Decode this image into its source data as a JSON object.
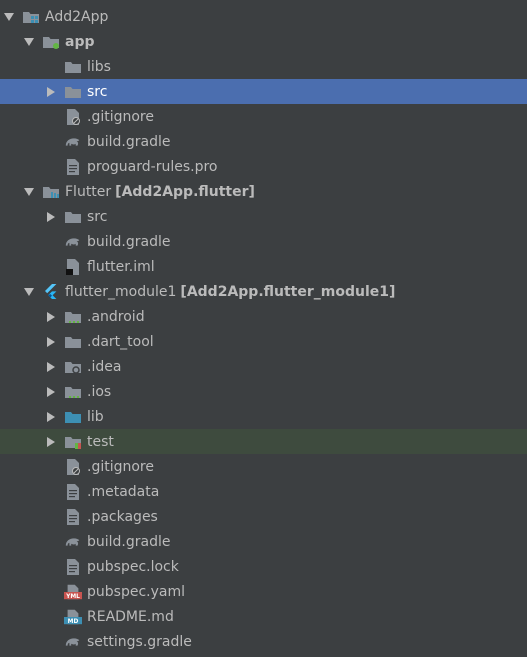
{
  "colors": {
    "background": "#3c3f41",
    "selected_row": "#4b6eaf",
    "highlight_row": "#3e4b3e",
    "folder": "#8a9199",
    "text": "#bbbbbb"
  },
  "rows": [
    {
      "id": "add2app",
      "label": "Add2App",
      "depth": 0,
      "arrow": "down",
      "icon": "project-module-icon",
      "bold": false,
      "suffix": ""
    },
    {
      "id": "app",
      "label": "app",
      "depth": 1,
      "arrow": "down",
      "icon": "android-module-folder-icon",
      "bold": true,
      "suffix": ""
    },
    {
      "id": "libs",
      "label": "libs",
      "depth": 2,
      "arrow": "none",
      "icon": "folder-icon",
      "bold": false,
      "suffix": ""
    },
    {
      "id": "src",
      "label": "src",
      "depth": 2,
      "arrow": "right",
      "icon": "folder-icon",
      "bold": false,
      "suffix": "",
      "selected": true
    },
    {
      "id": "app-gitignore",
      "label": ".gitignore",
      "depth": 2,
      "arrow": "none",
      "icon": "ignore-file-icon",
      "bold": false,
      "suffix": ""
    },
    {
      "id": "app-build-gradle",
      "label": "build.gradle",
      "depth": 2,
      "arrow": "none",
      "icon": "gradle-icon",
      "bold": false,
      "suffix": ""
    },
    {
      "id": "proguard",
      "label": "proguard-rules.pro",
      "depth": 2,
      "arrow": "none",
      "icon": "text-file-icon",
      "bold": false,
      "suffix": ""
    },
    {
      "id": "flutter",
      "label": "Flutter",
      "depth": 1,
      "arrow": "down",
      "icon": "library-module-folder-icon",
      "bold": false,
      "suffix": "[Add2App.flutter]"
    },
    {
      "id": "flutter-src",
      "label": "src",
      "depth": 2,
      "arrow": "right",
      "icon": "folder-icon",
      "bold": false,
      "suffix": ""
    },
    {
      "id": "flutter-build-gradle",
      "label": "build.gradle",
      "depth": 2,
      "arrow": "none",
      "icon": "gradle-icon",
      "bold": false,
      "suffix": ""
    },
    {
      "id": "flutter-iml",
      "label": "flutter.iml",
      "depth": 2,
      "arrow": "none",
      "icon": "iml-file-icon",
      "bold": false,
      "suffix": ""
    },
    {
      "id": "flutter-module1",
      "label": "flutter_module1",
      "depth": 1,
      "arrow": "down",
      "icon": "flutter-icon",
      "bold": false,
      "suffix": "[Add2App.flutter_module1]"
    },
    {
      "id": "android",
      "label": ".android",
      "depth": 2,
      "arrow": "right",
      "icon": "folder-dots-icon",
      "bold": false,
      "suffix": ""
    },
    {
      "id": "dart-tool",
      "label": ".dart_tool",
      "depth": 2,
      "arrow": "right",
      "icon": "folder-icon",
      "bold": false,
      "suffix": ""
    },
    {
      "id": "idea",
      "label": ".idea",
      "depth": 2,
      "arrow": "right",
      "icon": "folder-gear-icon",
      "bold": false,
      "suffix": ""
    },
    {
      "id": "ios",
      "label": ".ios",
      "depth": 2,
      "arrow": "right",
      "icon": "folder-dots-icon",
      "bold": false,
      "suffix": ""
    },
    {
      "id": "lib",
      "label": "lib",
      "depth": 2,
      "arrow": "right",
      "icon": "source-folder-icon",
      "bold": false,
      "suffix": ""
    },
    {
      "id": "test",
      "label": "test",
      "depth": 2,
      "arrow": "right",
      "icon": "test-folder-icon",
      "bold": false,
      "suffix": "",
      "highlight": true
    },
    {
      "id": "fm-gitignore",
      "label": ".gitignore",
      "depth": 2,
      "arrow": "none",
      "icon": "ignore-file-icon",
      "bold": false,
      "suffix": ""
    },
    {
      "id": "metadata",
      "label": ".metadata",
      "depth": 2,
      "arrow": "none",
      "icon": "text-file-icon",
      "bold": false,
      "suffix": ""
    },
    {
      "id": "packages",
      "label": ".packages",
      "depth": 2,
      "arrow": "none",
      "icon": "text-file-icon",
      "bold": false,
      "suffix": ""
    },
    {
      "id": "fm-build-gradle",
      "label": "build.gradle",
      "depth": 2,
      "arrow": "none",
      "icon": "gradle-icon",
      "bold": false,
      "suffix": ""
    },
    {
      "id": "pubspec-lock",
      "label": "pubspec.lock",
      "depth": 2,
      "arrow": "none",
      "icon": "text-file-icon",
      "bold": false,
      "suffix": ""
    },
    {
      "id": "pubspec-yaml",
      "label": "pubspec.yaml",
      "depth": 2,
      "arrow": "none",
      "icon": "yaml-file-icon",
      "bold": false,
      "suffix": ""
    },
    {
      "id": "readme",
      "label": "README.md",
      "depth": 2,
      "arrow": "none",
      "icon": "markdown-file-icon",
      "bold": false,
      "suffix": ""
    },
    {
      "id": "settings-gradle",
      "label": "settings.gradle",
      "depth": 2,
      "arrow": "none",
      "icon": "gradle-icon",
      "bold": false,
      "suffix": ""
    }
  ]
}
